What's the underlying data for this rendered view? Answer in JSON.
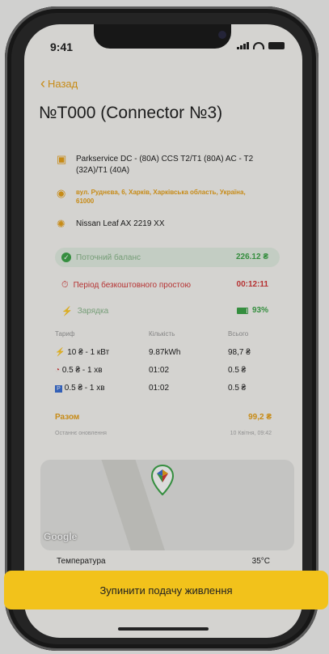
{
  "status_bar": {
    "time": "9:41"
  },
  "nav": {
    "back_label": "Назад"
  },
  "title": "№T000 (Connector №3)",
  "station": {
    "name": "Parkservice DC - (80A) CCS T2/T1 (80A) AC - T2 (32A)/T1 (40A)",
    "address": "вул. Руднєва, 6, Харків, Харківська область, Україна, 61000",
    "vehicle": "Nissan Leaf AX 2219 XX"
  },
  "balance": {
    "label": "Поточний баланс",
    "value": "226.12 ₴"
  },
  "idle": {
    "label": "Період безкоштовного простою",
    "value": "00:12:11"
  },
  "charging": {
    "label": "Зарядка",
    "value": "93%",
    "percent": 93
  },
  "tariff_table": {
    "headers": [
      "Тариф",
      "Кількість",
      "Всього"
    ],
    "rows": [
      {
        "tariff": "10 ₴ - 1 кВт",
        "quantity": "9.87kWh",
        "total": "98,7 ₴"
      },
      {
        "tariff": "0.5 ₴ - 1 хв",
        "quantity": "01:02",
        "total": "0.5 ₴"
      },
      {
        "tariff": "0.5 ₴ - 1 хв",
        "quantity": "01:02",
        "total": "0.5 ₴"
      }
    ]
  },
  "summary": {
    "total_label": "Разом",
    "total_value": "99,2 ₴",
    "last_update_label": "Останнє оновлення",
    "last_update_value": "10 Квітня, 09:42"
  },
  "map": {
    "logo": "Google"
  },
  "temperature": {
    "label": "Температура",
    "value": "35°C"
  },
  "actions": {
    "stop_label": "Зупинити подачу живлення"
  },
  "colors": {
    "accent": "#e8a21a",
    "button": "#f2c21b",
    "green": "#3ea64a",
    "red": "#d43b3b"
  }
}
